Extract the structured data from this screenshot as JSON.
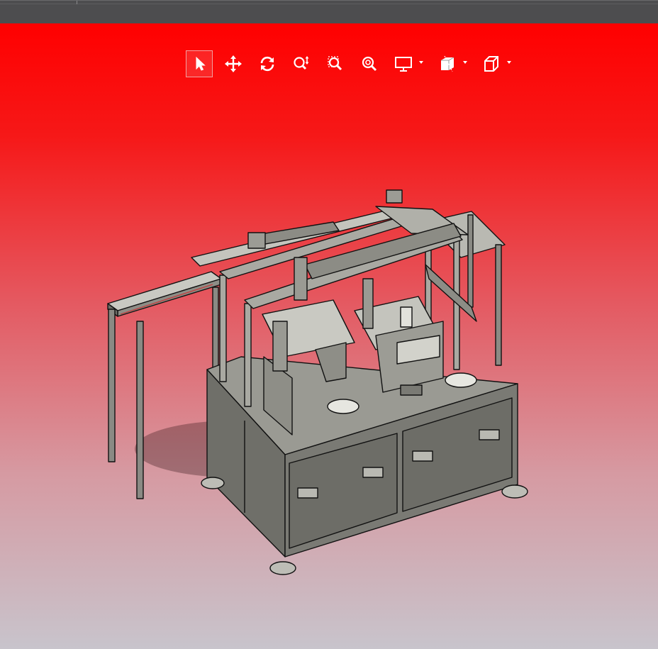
{
  "window": {
    "title_bar": ""
  },
  "viewport": {
    "background": {
      "top_color": "#ff0000",
      "bottom_color": "#c8c4cc"
    },
    "model": {
      "description_icon": "industrial-machine-3d-model",
      "frame_color": "#7d7d78",
      "edge_color": "#1a1a1a"
    }
  },
  "toolbar": {
    "items": [
      {
        "name": "select-arrow-icon",
        "active": true,
        "menu": false
      },
      {
        "name": "pan-move-icon",
        "active": false,
        "menu": false
      },
      {
        "name": "rotate-icon",
        "active": false,
        "menu": false
      },
      {
        "name": "zoom-in-out-icon",
        "active": false,
        "menu": false
      },
      {
        "name": "zoom-to-area-icon",
        "active": false,
        "menu": false
      },
      {
        "name": "zoom-to-fit-icon",
        "active": false,
        "menu": false
      },
      {
        "name": "display-style-icon",
        "active": false,
        "menu": true
      },
      {
        "name": "section-view-icon",
        "active": false,
        "menu": true
      },
      {
        "name": "view-orientation-cube-icon",
        "active": false,
        "menu": true
      }
    ]
  }
}
